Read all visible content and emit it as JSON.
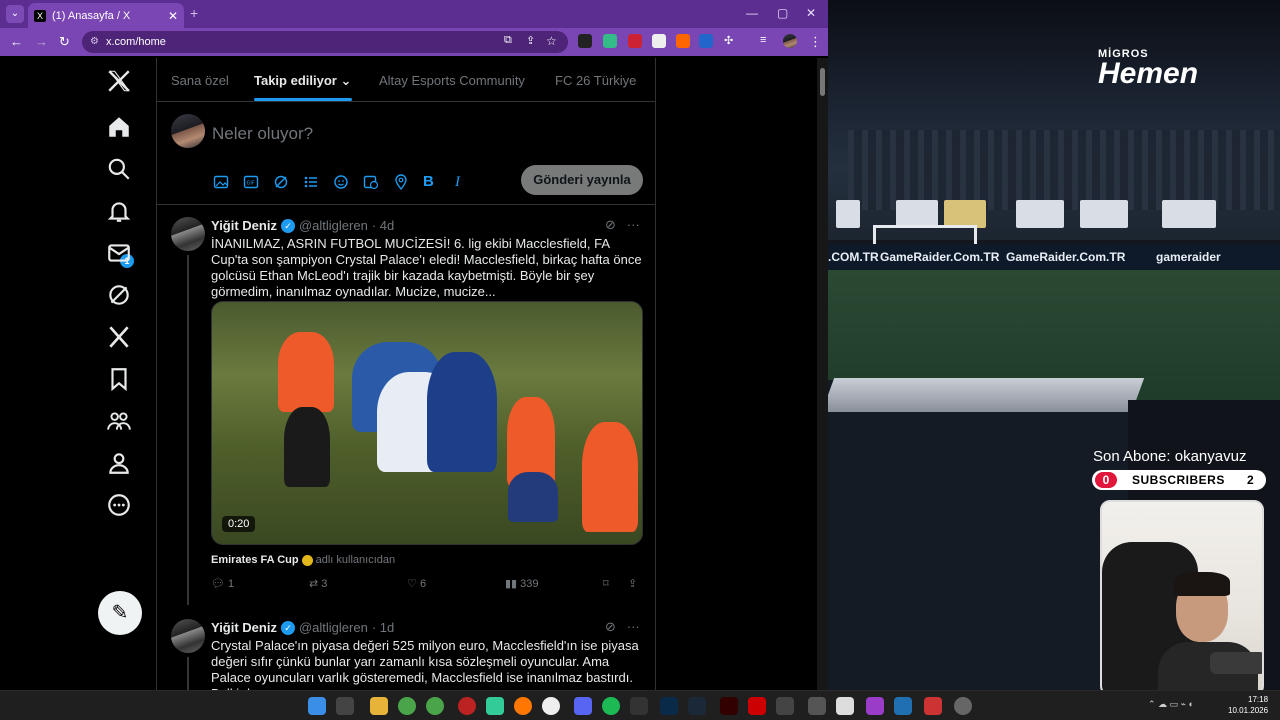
{
  "browser": {
    "tab_title": "(1) Anasayfa / X",
    "tab_favicon": "X",
    "url": "x.com/home"
  },
  "sidebar": {
    "notification_count": "1",
    "icons": [
      "x-logo-icon",
      "home-icon",
      "search-icon",
      "bell-icon",
      "mail-icon",
      "grok-icon",
      "x-premium-icon",
      "bookmark-icon",
      "communities-icon",
      "profile-icon",
      "more-icon"
    ]
  },
  "feed_tabs": [
    "Sana özel",
    "Takip ediliyor",
    "Altay Esports Community",
    "FC 26 Türkiye"
  ],
  "compose": {
    "placeholder": "Neler oluyor?",
    "post_button": "Gönderi yayınla"
  },
  "tweets": [
    {
      "name": "Yiğit Deniz",
      "handle": "@altligleren",
      "time": "· 4d",
      "text": "İNANILMAZ, ASRIN FUTBOL MUCİZESİ! 6. lig ekibi Macclesfield, FA Cup'ta son şampiyon Crystal Palace'ı eledi! Macclesfield, birkaç hafta önce golcüsü Ethan McLeod'ı trajik bir kazada kaybetmişti. Böyle bir şey görmedim, inanılmaz oynadılar. Mucize, mucize...",
      "video_duration": "0:20",
      "source_name": "Emirates FA Cup",
      "source_suffix": "adlı kullanıcıdan",
      "replies": "1",
      "reposts": "3",
      "likes": "6",
      "views": "339"
    },
    {
      "name": "Yiğit Deniz",
      "handle": "@altligleren",
      "time": "· 1d",
      "text": "Crystal Palace'ın piyasa değeri 525 milyon euro, Macclesfield'ın ise piyasa değeri sıfır çünkü bunlar yarı zamanlı kısa sözleşmeli oyuncular. Ama Palace oyuncuları varlık gösteremedi, Macclesfield ise inanılmaz bastırdı. Belki de"
    }
  ],
  "stream": {
    "sponsor_top": "MİGROS",
    "sponsor_main": "Hemen",
    "ad_text_1": ".COM.TR",
    "ad_text_2": "GameRaider.Com.TR",
    "ad_text_3": "GameRaider.Com.TR",
    "ad_text_4": "gameraider",
    "last_sub": "Son Abone: okanyavuz",
    "sub_left": "0",
    "sub_label": "SUBSCRIBERS",
    "sub_right": "2"
  },
  "taskbar": {
    "time": "17:18",
    "date": "10.01.2026"
  },
  "colors": {
    "accent": "#1d9bf0",
    "browser_frame": "#7a46b3",
    "background": "#000000"
  }
}
